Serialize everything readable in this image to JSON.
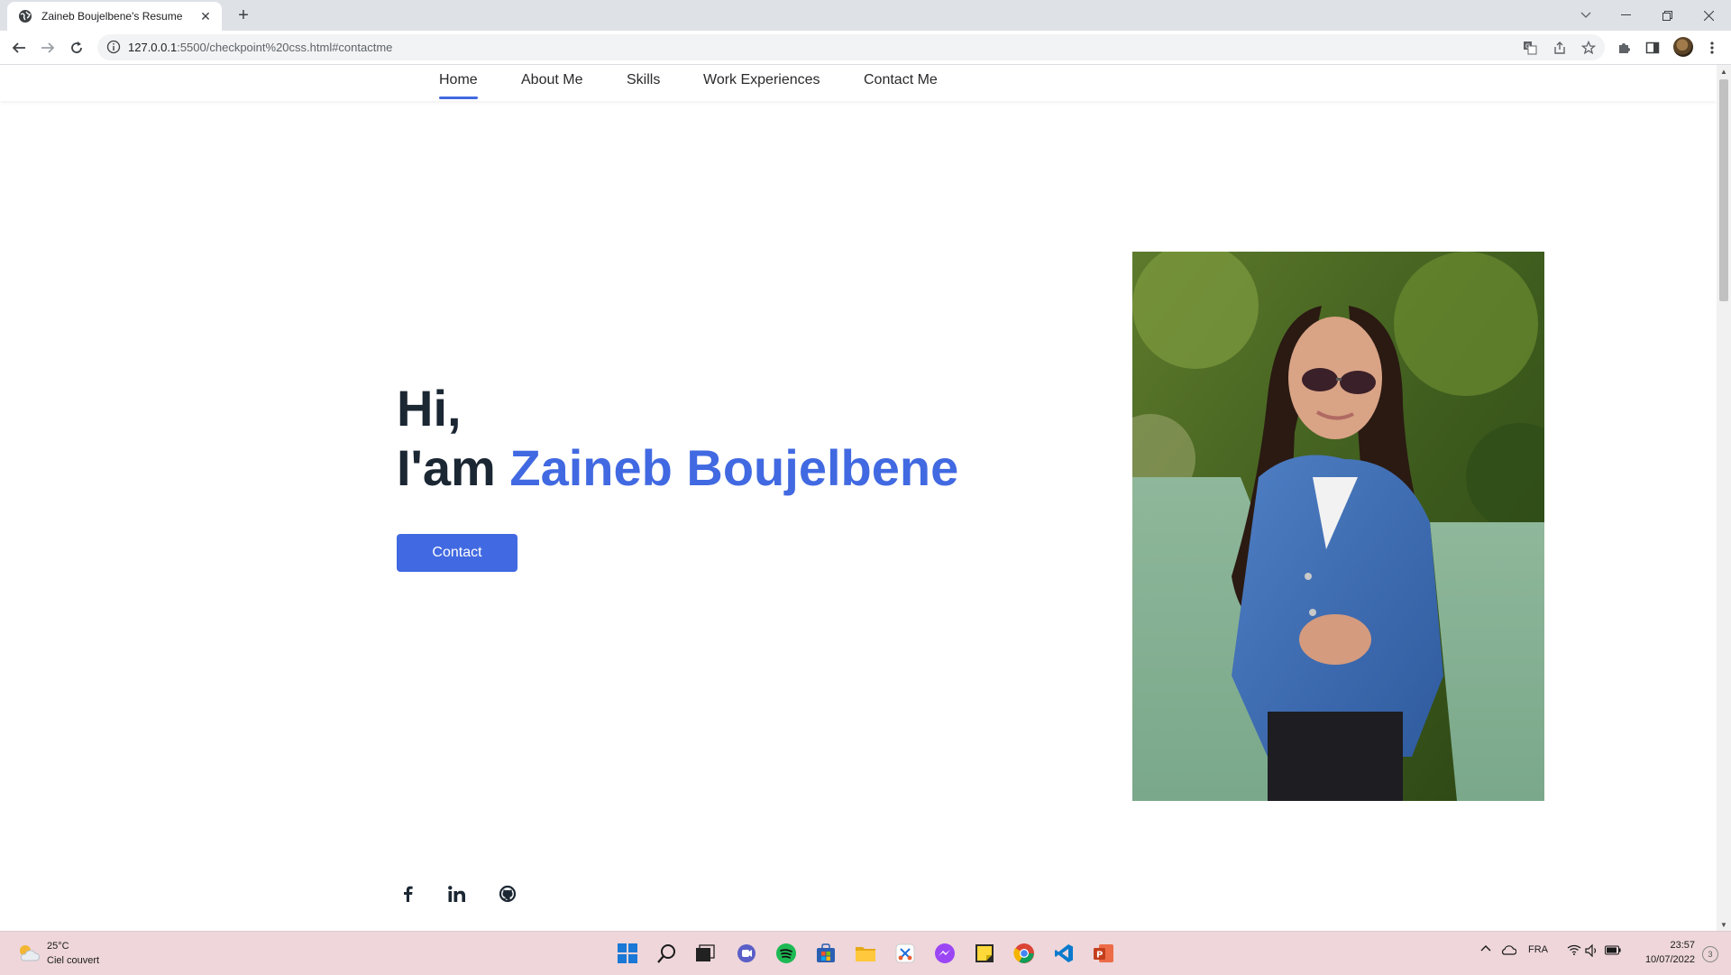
{
  "browser": {
    "tab_title": "Zaineb Boujelbene's Resume",
    "url_host": "127.0.0.1",
    "url_path": ":5500/checkpoint%20css.html#contactme"
  },
  "nav": {
    "links": [
      "Home",
      "About Me",
      "Skills",
      "Work Experiences",
      "Contact Me"
    ],
    "active": "Home",
    "accent_color": "#4169e1"
  },
  "hero": {
    "greeting": "Hi,",
    "intro": "I'am ",
    "name": "Zaineb Boujelbene",
    "contact_label": "Contact",
    "photo_icon": "profile-photo"
  },
  "social": [
    "facebook-icon",
    "linkedin-icon",
    "github-icon"
  ],
  "taskbar": {
    "temperature": "25°C",
    "weather": "Ciel couvert",
    "language": "FRA",
    "time": "23:57",
    "date": "10/07/2022",
    "notifications": "3"
  }
}
